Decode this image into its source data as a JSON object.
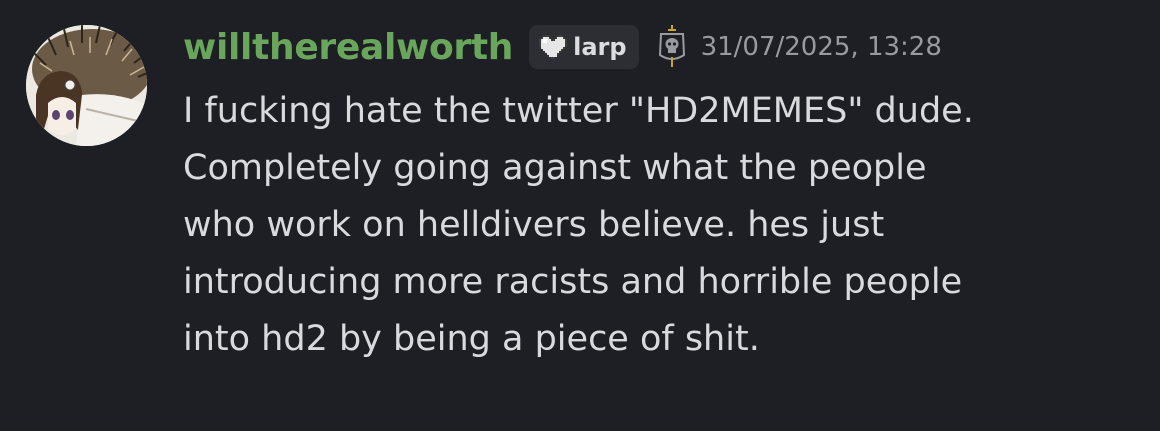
{
  "message": {
    "author": {
      "username": "willtherealworth",
      "username_color": "#69a65c",
      "avatar_icon": "anime-girl-hedgehog-avatar",
      "tag": {
        "icon": "pixel-heart-icon",
        "label": "larp"
      },
      "role_icon": "skull-sword-emblem-icon"
    },
    "timestamp": "31/07/2025, 13:28",
    "lines": [
      "I fucking hate the twitter \"HD2MEMES\" dude.",
      "Completely going against what the people",
      "who work on helldivers believe. hes just",
      "introducing more racists and horrible people",
      "into hd2 by being a piece of shit."
    ]
  },
  "colors": {
    "background": "#1e1f24",
    "text": "#d9dadd",
    "timestamp": "#989aa2",
    "tag_background": "#2d2e33"
  }
}
